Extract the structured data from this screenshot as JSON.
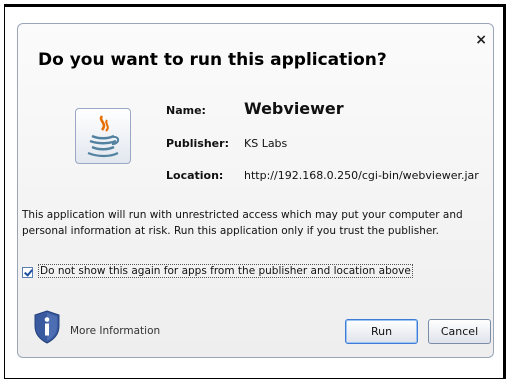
{
  "dialog": {
    "title": "Do you want to run this application?",
    "close_label": "×"
  },
  "app_info": {
    "name_label": "Name:",
    "name_value": "Webviewer",
    "publisher_label": "Publisher:",
    "publisher_value": "KS Labs",
    "location_label": "Location:",
    "location_value": "http://192.168.0.250/cgi-bin/webviewer.jar",
    "icon": "java-coffee-cup-icon"
  },
  "warning": {
    "line1": "This application will run with unrestricted access which may put your computer and",
    "line2": "personal information at risk. Run this application only if you trust the publisher."
  },
  "checkbox": {
    "checked": true,
    "label": "Do not show this again for apps from the publisher and location above"
  },
  "footer": {
    "info_icon": "shield-info-icon",
    "more_info_label": "More Information",
    "run_label": "Run",
    "cancel_label": "Cancel"
  },
  "colors": {
    "shield": "#3a5aa0",
    "java_orange": "#e76f00",
    "java_blue": "#5382a1"
  }
}
